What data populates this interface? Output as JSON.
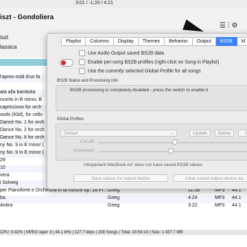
{
  "player": {
    "time": "3:01 / -1:20 / 4:21",
    "title": "iszt - Gondoliera",
    "artist": "iszt",
    "genre": "lassica"
  },
  "icons": {
    "list": "list-icon",
    "equalizer": "equalizer-icon",
    "settings": "gear-icon"
  },
  "tracks": [
    {
      "title": ""
    },
    {
      "title": "l'apres-midi d'un fa"
    },
    {
      "title": ""
    },
    {
      "title": "ata alla bambola"
    },
    {
      "title": "ncerto in B minor, B"
    },
    {
      "title": "capriccioso for orch"
    },
    {
      "title": "oods (Klid), for cello"
    },
    {
      "title": "Dance No. 1 for orch"
    },
    {
      "title": "Dance No. 2 for orch"
    },
    {
      "title": "Dance No. 8 for orch"
    },
    {
      "title": "ny No. 9 in E minor ("
    },
    {
      "title": "ny No. 9 in E minor ("
    },
    {
      "title": "29"
    },
    {
      "title": "10"
    },
    {
      "title": "vera"
    },
    {
      "title": "i Solveig"
    },
    {
      "title": "per Pianoforte e Orchestra in la minore op. 16 Pr...",
      "artist": "Grieg",
      "duration": "11:58",
      "format": "MP3",
      "bitrate": "44.1"
    },
    {
      "title": "ba",
      "artist": "Grieg",
      "duration": "4:24",
      "format": "MP3",
      "bitrate": "44.1"
    },
    {
      "title": "Anitra",
      "artist": "Grieg",
      "duration": "3:22",
      "format": "MP3",
      "bitrate": "44.1"
    }
  ],
  "status_bar": "CPU: 0.42% | MPEG layer 3 | 44.1 kHz | 127.7 kbps | 238 Songs | Total: 23:54:14 | Size: 1 437.7 MB",
  "prefs": {
    "tabs": [
      "Playlist",
      "Columns",
      "Display",
      "Themes",
      "Behavior",
      "Output",
      "BS2B",
      "M"
    ],
    "active_tab": "BS2B",
    "options": {
      "use_audio_output": "Use Audio Output saved BS2B data",
      "enable_per_song": "Enable per-song BS2B profiles (right-click on Song in Playlist)",
      "use_global": "Use the currently selected Global Profile for all songs"
    },
    "toggle_state": "off",
    "status_group_title": "BS2B Status and Processing Info",
    "status_message": "BS2B processing is completely disabled - press the switch to enable it",
    "global_group_title": "Global Profiles",
    "profile_select": "Default",
    "buttons": {
      "update": "Update",
      "delete": "Delete",
      "save": "Sav"
    },
    "cutoff_label": "Cut-off:",
    "crossfeed_label": "Crossfeed:",
    "cutoff_value": 0.48,
    "crossfeed_value": 0.45,
    "device_note": "'Altoparlanti MacBook Air' does not have saved BS2B values",
    "save_values_button": "Save values for output device",
    "clear_values_button": "Clear saved output device da"
  },
  "colors": {
    "accent": "#3b82f6",
    "toggle_off": "#e0242a"
  }
}
